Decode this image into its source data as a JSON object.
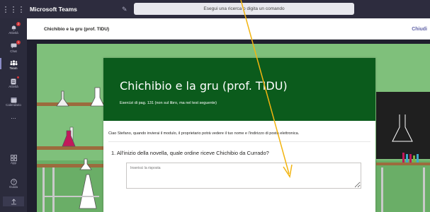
{
  "topbar": {
    "app_name": "Microsoft Teams",
    "search_placeholder": "Esegui una ricerca o digita un comando"
  },
  "rail": {
    "items": [
      {
        "label": "Attività",
        "icon": "bell-icon",
        "badge": "2"
      },
      {
        "label": "Chat",
        "icon": "chat-icon",
        "badge": "1"
      },
      {
        "label": "Team",
        "icon": "teams-icon"
      },
      {
        "label": "Attività",
        "icon": "assignments-icon"
      },
      {
        "label": "Calendario",
        "icon": "calendar-icon"
      },
      {
        "label": "...",
        "icon": "more-icon"
      }
    ],
    "bottom_items": [
      {
        "label": "App",
        "icon": "apps-icon"
      },
      {
        "label": "Guida",
        "icon": "help-icon"
      }
    ]
  },
  "content": {
    "title": "Chichibio e la gru (prof. TIDU)",
    "close_label": "Chiudi"
  },
  "form": {
    "title": "Chichibio e la gru (prof. TIDU)",
    "description": "Esercizi di pag. 131 (non sul libro, ma nel test seguente)",
    "notice": "Ciao Stefano, quando invierai il modulo, il proprietario potrà vedere il tuo nome e l'indirizzo di posta elettronica.",
    "question": "1. All'inizio della novella, quale ordine riceve Chichibio da Currado?",
    "answer_placeholder": "Inserisci la risposta"
  },
  "colors": {
    "teams_purple": "#6264a7",
    "form_header": "#0b5b1c",
    "lab_wall": "#7fc07b",
    "annotation_arrow": "#f2b410"
  }
}
